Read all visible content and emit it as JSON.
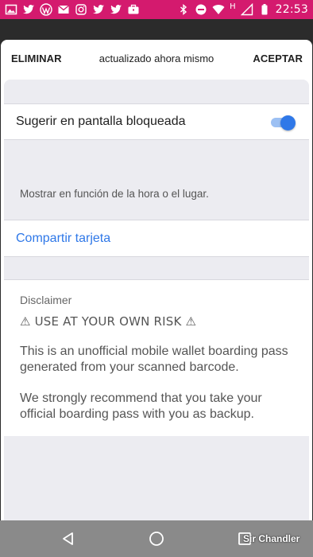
{
  "status_bar": {
    "time": "22:53",
    "network_letter": "H",
    "color": "#d41a6e",
    "left_icons": [
      "image-icon",
      "twitter-icon",
      "wordpress-icon",
      "gmail-icon",
      "instagram-icon",
      "twitter-icon",
      "twitter-icon",
      "briefcase-icon"
    ],
    "right_icons": [
      "bluetooth-icon",
      "do-not-disturb-icon",
      "wifi-icon",
      "signal-icon",
      "battery-icon"
    ]
  },
  "top_bar": {
    "left_label": "ELIMINAR",
    "center_label": "actualizado ahora mismo",
    "right_label": "ACEPTAR"
  },
  "settings": {
    "lock_screen_label": "Sugerir en pantalla bloqueada",
    "lock_screen_enabled": true,
    "lock_screen_hint": "Mostrar en función de la hora o el lugar.",
    "share_label": "Compartir tarjeta"
  },
  "disclaimer": {
    "title": "Disclaimer",
    "warning": "⚠ USE AT YOUR OWN RISK ⚠",
    "paragraph1": "This is an unofficial mobile wallet boarding pass generated from your scanned barcode.",
    "paragraph2": "We strongly recommend that you take your official boarding pass with you as backup."
  },
  "watermark": "Sir Chandler",
  "colors": {
    "accent": "#2f78e8",
    "status_bar": "#d41a6e",
    "background": "#ececf1"
  }
}
